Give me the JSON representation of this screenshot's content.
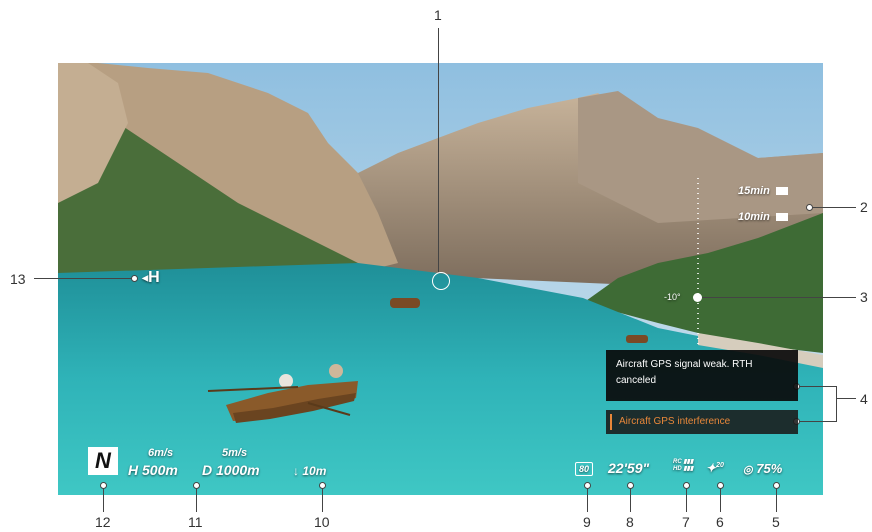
{
  "callouts": [
    "1",
    "2",
    "3",
    "4",
    "5",
    "6",
    "7",
    "8",
    "9",
    "10",
    "11",
    "12",
    "13"
  ],
  "flight": {
    "timers": [
      {
        "value": "15min"
      },
      {
        "value": "10min"
      }
    ],
    "gimbal_angle": "-10°",
    "notice_text": "Aircraft GPS signal weak. RTH canceled",
    "warning_text": "Aircraft GPS interference",
    "battery": "75%",
    "gps_count": "20",
    "rc_label": "RC",
    "hd_label": "HD",
    "flight_time": "22'59\"",
    "battery_box": "80",
    "altitude_speed": "6m/s",
    "altitude": "H 500m",
    "distance_speed": "5m/s",
    "distance": "D 1000m",
    "vision_distance": "10m",
    "mode": "N",
    "home_label": "H"
  },
  "colors": {
    "warning": "#e8873a",
    "notice_bg": "#0a0a0a",
    "lake": "#2fb3b8",
    "sky": "#a9cde4"
  }
}
